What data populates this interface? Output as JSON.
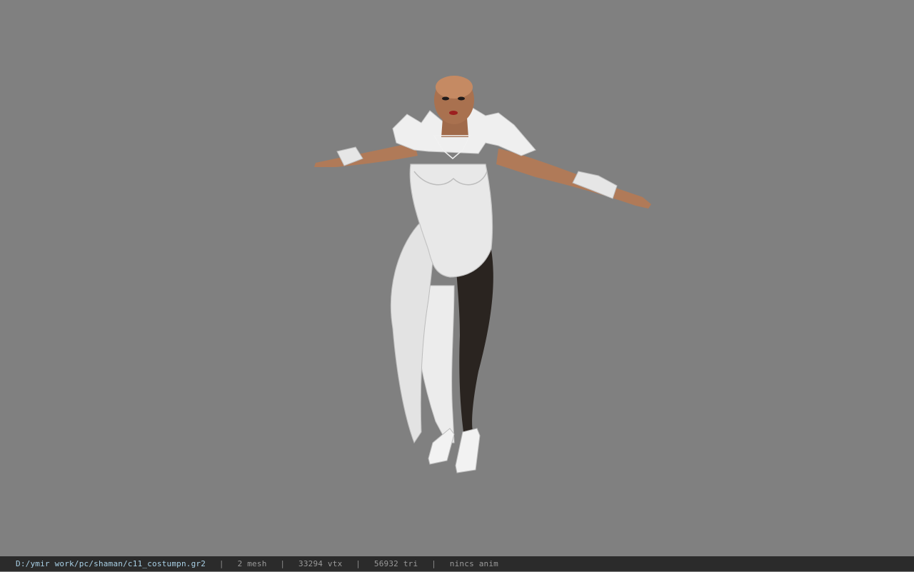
{
  "viewport": {
    "background_color": "#808080",
    "model_description_icon": "character-model"
  },
  "status_bar": {
    "file_path": "D:/ymir work/pc/shaman/c11_costumpn.gr2",
    "separator": "|",
    "mesh_count": "2 mesh",
    "vertex_count": "33294 vtx",
    "triangle_count": "56932 tri",
    "anim_status": "nincs anim"
  },
  "colors": {
    "status_bg": "#2b2b2b",
    "path_text": "#a9d0e6",
    "info_text": "#9a9a9a"
  }
}
